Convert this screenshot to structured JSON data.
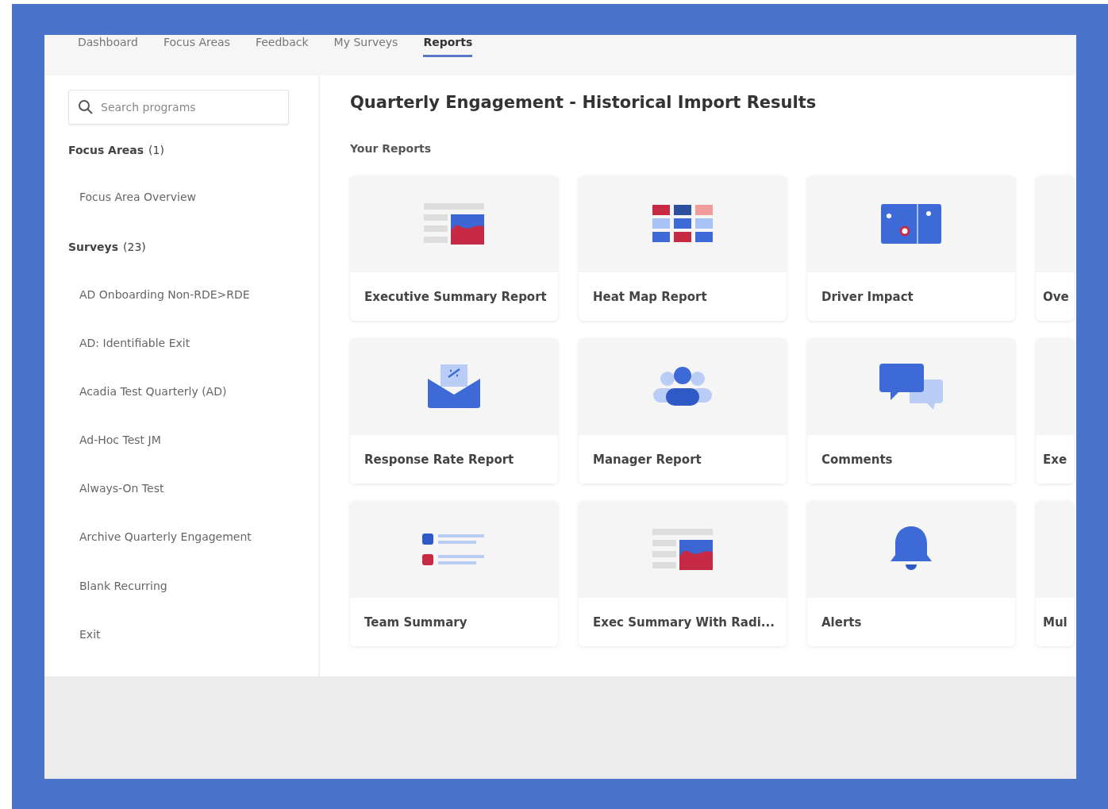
{
  "tabs": [
    {
      "label": "Dashboard",
      "selected": false
    },
    {
      "label": "Focus Areas",
      "selected": false
    },
    {
      "label": "Feedback",
      "selected": false
    },
    {
      "label": "My Surveys",
      "selected": false
    },
    {
      "label": "Reports",
      "selected": true
    }
  ],
  "sidebar": {
    "search": {
      "placeholder": "Search programs"
    },
    "sections": [
      {
        "heading": "Focus Areas",
        "count": "(1)",
        "items": [
          "Focus Area Overview"
        ]
      },
      {
        "heading": "Surveys",
        "count": "(23)",
        "items": [
          "AD Onboarding Non-RDE>RDE",
          "AD: Identifiable Exit",
          "Acadia Test Quarterly (AD)",
          "Ad-Hoc Test JM",
          "Always-On Test",
          "Archive Quarterly Engagement",
          "Blank Recurring",
          "Exit"
        ]
      }
    ]
  },
  "main": {
    "title": "Quarterly Engagement - Historical Import Results",
    "subtitle": "Your Reports",
    "rows": [
      [
        {
          "label": "Executive Summary Report",
          "kind": "summary"
        },
        {
          "label": "Heat Map Report",
          "kind": "heatmap"
        },
        {
          "label": "Driver Impact",
          "kind": "driver"
        },
        {
          "label": "Ove"
        }
      ],
      [
        {
          "label": "Response Rate Report",
          "kind": "envelope"
        },
        {
          "label": "Manager Report",
          "kind": "people"
        },
        {
          "label": "Comments",
          "kind": "chat"
        },
        {
          "label": "Exe"
        }
      ],
      [
        {
          "label": "Team Summary",
          "kind": "list"
        },
        {
          "label": "Exec Summary With Radi...",
          "kind": "summary"
        },
        {
          "label": "Alerts",
          "kind": "bell"
        },
        {
          "label": "Mul"
        }
      ]
    ]
  }
}
